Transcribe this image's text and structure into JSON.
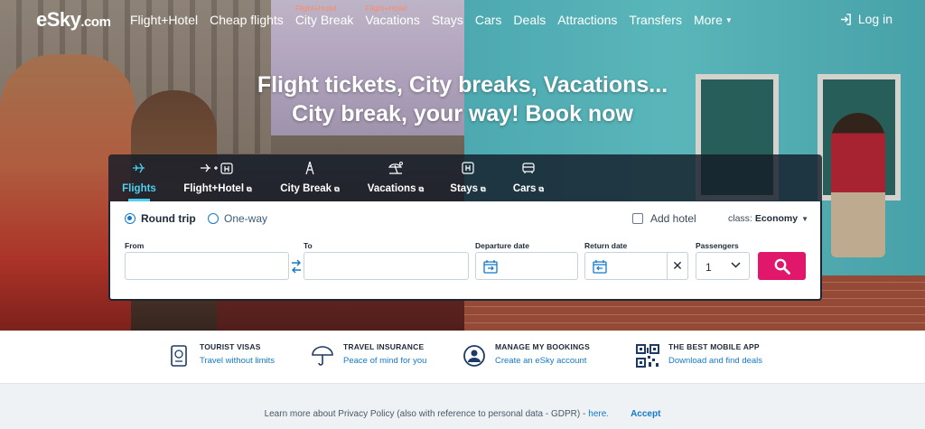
{
  "brand": {
    "logo_main": "eSky",
    "logo_suffix": ".com"
  },
  "nav": {
    "items": [
      {
        "label": "Flight+Hotel",
        "super": ""
      },
      {
        "label": "Cheap flights",
        "super": ""
      },
      {
        "label": "City Break",
        "super": "Flight+Hotel"
      },
      {
        "label": "Vacations",
        "super": "Flight+Hotel"
      },
      {
        "label": "Stays",
        "super": ""
      },
      {
        "label": "Cars",
        "super": ""
      },
      {
        "label": "Deals",
        "super": ""
      },
      {
        "label": "Attractions",
        "super": ""
      },
      {
        "label": "Transfers",
        "super": ""
      }
    ],
    "more_label": "More",
    "login_label": "Log in"
  },
  "hero": {
    "headline_line1": "Flight tickets, City breaks, Vacations...",
    "headline_line2": "City break, your way! Book now"
  },
  "search": {
    "tabs": [
      {
        "label": "Flights",
        "icon": "plane-icon",
        "active": true
      },
      {
        "label": "Flight+Hotel",
        "icon": "plane-hotel-icon",
        "active": false
      },
      {
        "label": "City Break",
        "icon": "eiffel-tower-icon",
        "active": false
      },
      {
        "label": "Vacations",
        "icon": "beach-umbrella-icon",
        "active": false
      },
      {
        "label": "Stays",
        "icon": "hotel-icon",
        "active": false
      },
      {
        "label": "Cars",
        "icon": "car-icon",
        "active": false
      }
    ],
    "trip_round": "Round trip",
    "trip_oneway": "One-way",
    "add_hotel": "Add hotel",
    "class_label": "class:",
    "class_value": "Economy",
    "from_label": "From",
    "to_label": "To",
    "departure_label": "Departure date",
    "return_label": "Return date",
    "passengers_label": "Passengers",
    "passengers_value": "1",
    "from_value": "",
    "to_value": ""
  },
  "features": [
    {
      "title": "TOURIST VISAS",
      "link": "Travel without limits",
      "icon": "passport-icon"
    },
    {
      "title": "TRAVEL INSURANCE",
      "link": "Peace of mind for you",
      "icon": "umbrella-icon"
    },
    {
      "title": "MANAGE MY BOOKINGS",
      "link": "Create an eSky account",
      "icon": "user-circle-icon"
    },
    {
      "title": "THE BEST MOBILE APP",
      "link": "Download and find deals",
      "icon": "qr-code-icon"
    }
  ],
  "cookie": {
    "text": "Learn more about Privacy Policy (also with reference to personal data - GDPR) -",
    "here": "here.",
    "accept": "Accept"
  },
  "colors": {
    "accent": "#4fd0ef",
    "link": "#1479c9",
    "search_button": "#e0176b",
    "nav_super": "#ff8a63"
  }
}
